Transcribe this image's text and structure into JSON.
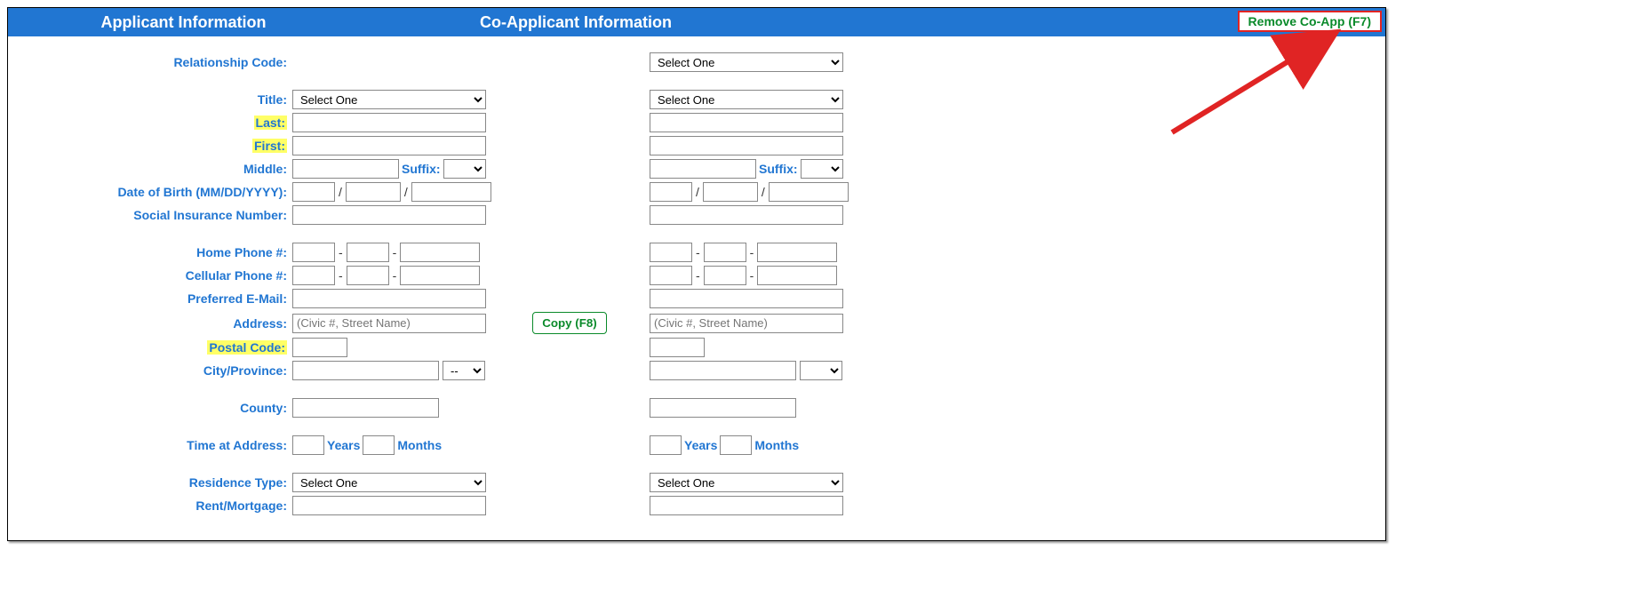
{
  "header": {
    "applicant": "Applicant Information",
    "coapplicant": "Co-Applicant Information",
    "remove_btn": "Remove Co-App  (F7)"
  },
  "labels": {
    "relationship": "Relationship Code:",
    "title": "Title:",
    "last": "Last:",
    "first": "First:",
    "middle": "Middle:",
    "suffix": "Suffix:",
    "dob": "Date of Birth (MM/DD/YYYY):",
    "sin": "Social Insurance Number:",
    "home_phone": "Home Phone #:",
    "cell_phone": "Cellular Phone #:",
    "email": "Preferred E-Mail:",
    "address": "Address:",
    "postal": "Postal Code:",
    "cityprov": "City/Province:",
    "county": "County:",
    "time_addr": "Time at Address:",
    "years": "Years",
    "months": "Months",
    "res_type": "Residence Type:",
    "rent_mort": "Rent/Mortgage:"
  },
  "options": {
    "select_one": "Select One",
    "prov_dash": "--"
  },
  "placeholders": {
    "address": "(Civic #, Street Name)"
  },
  "buttons": {
    "copy": "Copy (F8)"
  }
}
